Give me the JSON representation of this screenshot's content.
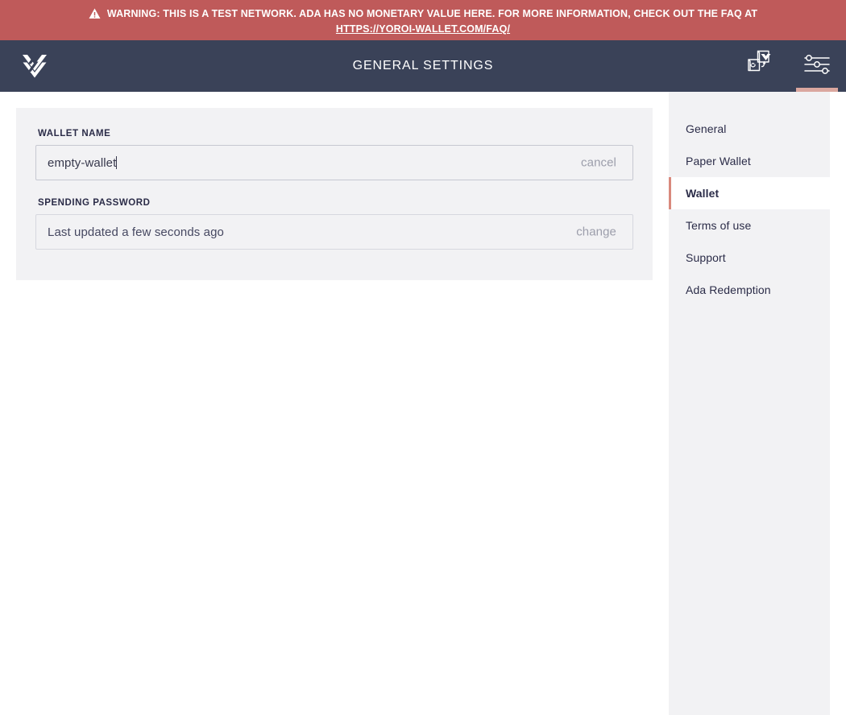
{
  "banner": {
    "icon": "warning-triangle-icon",
    "text": "WARNING: THIS IS A TEST NETWORK. ADA HAS NO MONETARY VALUE HERE. FOR MORE INFORMATION, CHECK OUT THE FAQ AT",
    "link_text": "HTTPS://YOROI-WALLET.COM/FAQ/",
    "bg_color": "#bf5a5a",
    "text_color": "#ffffff"
  },
  "topbar": {
    "logo_icon": "yoroi-logo-icon",
    "title": "GENERAL SETTINGS",
    "bg_color": "#3a4258",
    "actions": [
      {
        "icon": "wallet-switch-icon",
        "name": "wallet-switch-button",
        "active": false
      },
      {
        "icon": "settings-sliders-icon",
        "name": "settings-button",
        "active": true
      }
    ],
    "active_indicator_color": "#dba79f"
  },
  "settings": {
    "wallet_name": {
      "label": "WALLET NAME",
      "value": "empty-wallet",
      "placeholder": "Wallet name",
      "action_label": "cancel"
    },
    "spending_password": {
      "label": "SPENDING PASSWORD",
      "value": "Last updated a few seconds ago",
      "action_label": "change"
    }
  },
  "menu": {
    "active_border_color": "#d9897d",
    "items": [
      {
        "label": "General",
        "active": false
      },
      {
        "label": "Paper Wallet",
        "active": false
      },
      {
        "label": "Wallet",
        "active": true
      },
      {
        "label": "Terms of use",
        "active": false
      },
      {
        "label": "Support",
        "active": false
      },
      {
        "label": "Ada Redemption",
        "active": false
      }
    ]
  }
}
